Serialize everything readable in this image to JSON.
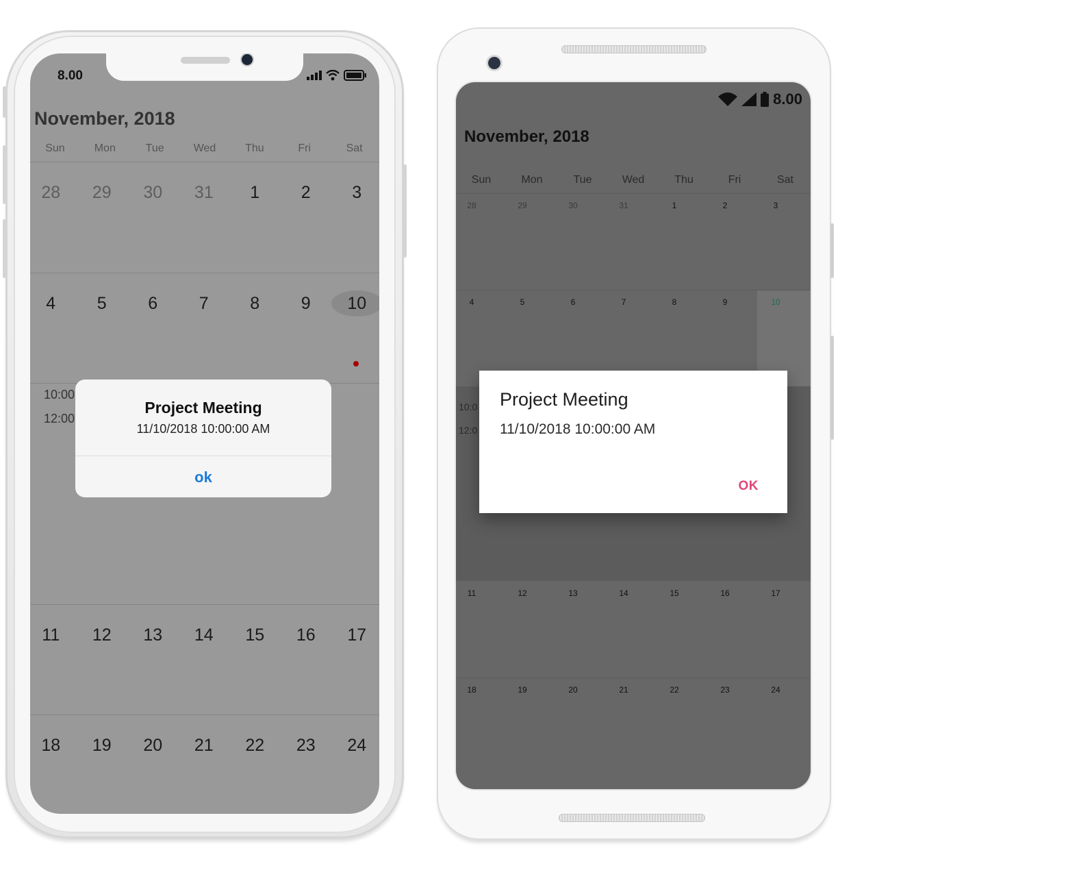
{
  "ios": {
    "status_time": "8.00",
    "month_title": "November, 2018",
    "weekdays": [
      "Sun",
      "Mon",
      "Tue",
      "Wed",
      "Thu",
      "Fri",
      "Sat"
    ],
    "weeks": [
      [
        "28",
        "29",
        "30",
        "31",
        "1",
        "2",
        "3"
      ],
      [
        "4",
        "5",
        "6",
        "7",
        "8",
        "9",
        "10"
      ],
      [
        "11",
        "12",
        "13",
        "14",
        "15",
        "16",
        "17"
      ],
      [
        "18",
        "19",
        "20",
        "21",
        "22",
        "23",
        "24"
      ]
    ],
    "agenda_times": [
      "10:00",
      "12:00"
    ],
    "alert": {
      "title": "Project Meeting",
      "message": "11/10/2018 10:00:00 AM",
      "ok_label": "ok"
    },
    "colors": {
      "accent": "#1a7bdb",
      "event_dot": "#a60000",
      "selected_day": "#1a1a8a"
    }
  },
  "android": {
    "status_time": "8.00",
    "month_title": "November, 2018",
    "weekdays": [
      "Sun",
      "Mon",
      "Tue",
      "Wed",
      "Thu",
      "Fri",
      "Sat"
    ],
    "weeks": [
      [
        "28",
        "29",
        "30",
        "31",
        "1",
        "2",
        "3"
      ],
      [
        "4",
        "5",
        "6",
        "7",
        "8",
        "9",
        "10"
      ],
      [
        "11",
        "12",
        "13",
        "14",
        "15",
        "16",
        "17"
      ],
      [
        "18",
        "19",
        "20",
        "21",
        "22",
        "23",
        "24"
      ]
    ],
    "agenda_times": [
      "10:0",
      "12:0"
    ],
    "dialog": {
      "title": "Project Meeting",
      "message": "11/10/2018 10:00:00 AM",
      "ok_label": "OK"
    },
    "colors": {
      "accent": "#e0457b",
      "selected_day": "#1c6b5a"
    }
  }
}
